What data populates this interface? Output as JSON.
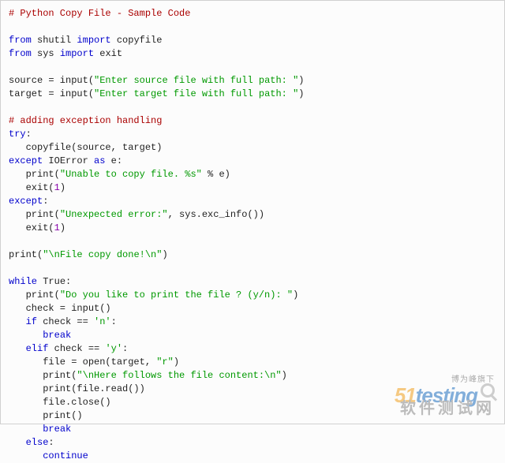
{
  "code": {
    "comment1": "# Python Copy File - Sample Code",
    "import1_from": "from",
    "import1_mod": " shutil ",
    "import1_imp": "import",
    "import1_name": " copyfile",
    "import2_from": "from",
    "import2_mod": " sys ",
    "import2_imp": "import",
    "import2_name": " exit",
    "src_var": "source = input(",
    "src_str": "\"Enter source file with full path: \"",
    "src_end": ")",
    "tgt_var": "target = input(",
    "tgt_str": "\"Enter target file with full path: \"",
    "tgt_end": ")",
    "comment2": "# adding exception handling",
    "try_kw": "try",
    "colon": ":",
    "copy_call": "   copyfile(source, target)",
    "except_kw": "except",
    "ioerror": " IOError ",
    "as_kw": "as",
    "as_name": " e:",
    "err1_a": "   print(",
    "err1_b": "\"Unable to copy file. %s\"",
    "err1_c": " % e)",
    "exit1_a": "   exit(",
    "exit1_b": "1",
    "exit1_c": ")",
    "except2": "except",
    "err2_a": "   print(",
    "err2_b": "\"Unexpected error:\"",
    "err2_c": ", sys.exc_info())",
    "exit2_a": "   exit(",
    "exit2_b": "1",
    "exit2_c": ")",
    "done_a": "print(",
    "done_b": "\"\\nFile copy done!\\n\"",
    "done_c": ")",
    "while_a": "while",
    "while_b": " True:",
    "ask_a": "   print(",
    "ask_b": "\"Do you like to print the file ? (y/n): \"",
    "ask_c": ")",
    "check_line": "   check = input()",
    "if_kw": "   if",
    "if_cond": " check == ",
    "if_str": "'n'",
    "break_kw": "break",
    "elif_kw": "   elif",
    "elif_cond": " check == ",
    "elif_str": "'y'",
    "open_a": "      file = open(target, ",
    "open_b": "\"r\"",
    "open_c": ")",
    "here_a": "      print(",
    "here_b": "\"\\nHere follows the file content:\\n\"",
    "here_c": ")",
    "read_line": "      print(file.read())",
    "close_line": "      file.close()",
    "print_empty": "      print()",
    "else_kw": "   else",
    "continue_kw": "continue"
  },
  "watermark": {
    "top": "博为峰旗下",
    "brand_orange": "51",
    "brand_blue": "testing",
    "cn": "软件测试网"
  }
}
